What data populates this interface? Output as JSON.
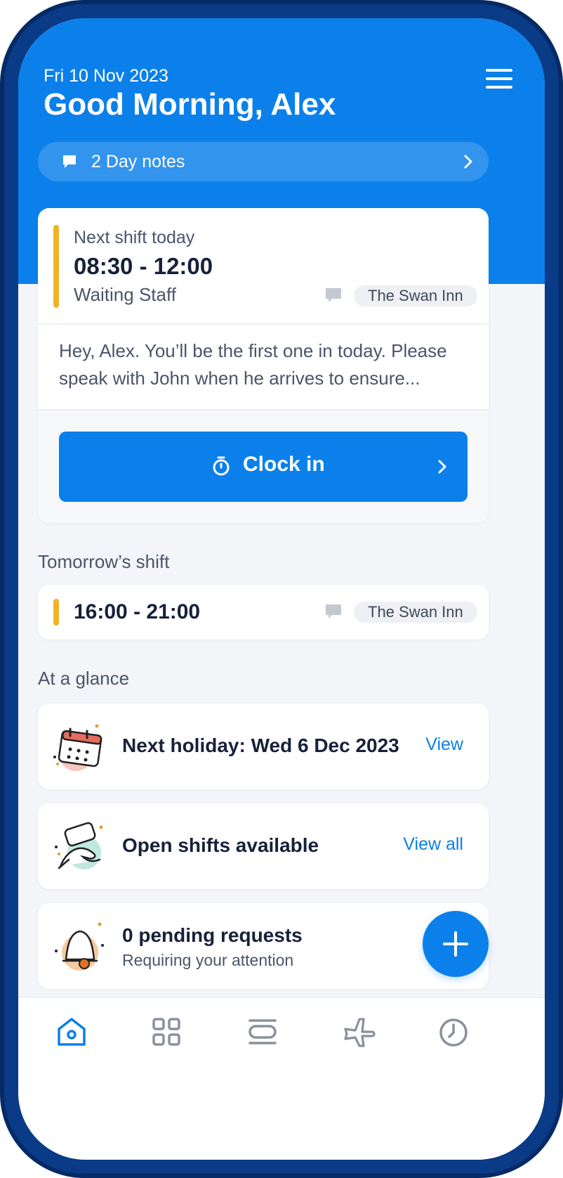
{
  "header": {
    "date": "Fri 10 Nov 2023",
    "greeting": "Good Morning, Alex",
    "day_notes": "2 Day notes"
  },
  "next_shift": {
    "kicker": "Next shift today",
    "time": "08:30 - 12:00",
    "role": "Waiting Staff",
    "location": "The Swan Inn",
    "note": "Hey, Alex. You’ll be the first one in today. Please speak with John when he arrives to ensure...",
    "clock_in_label": "Clock in"
  },
  "tomorrow": {
    "section_title": "Tomorrow’s shift",
    "time": "16:00 - 21:00",
    "location": "The Swan Inn"
  },
  "glance": {
    "section_title": "At a glance",
    "items": [
      {
        "title": "Next holiday: Wed 6 Dec 2023",
        "action": "View",
        "icon": "calendar-illustration"
      },
      {
        "title": "Open shifts available",
        "action": "View all",
        "icon": "hand-phone-illustration"
      },
      {
        "title": "0 pending requests",
        "subtitle": "Requiring your attention",
        "icon": "bell-illustration"
      }
    ]
  },
  "tabs": [
    {
      "name": "home-icon",
      "active": true
    },
    {
      "name": "apps-grid-icon",
      "active": false
    },
    {
      "name": "schedule-icon",
      "active": false
    },
    {
      "name": "airplane-icon",
      "active": false
    },
    {
      "name": "clock-icon",
      "active": false
    }
  ],
  "colors": {
    "primary": "#0b80ea",
    "accent_yellow": "#f0b323",
    "text_dark": "#16213a",
    "text_muted": "#4a5568",
    "background": "#f3f5f9",
    "frame": "#062a66"
  }
}
